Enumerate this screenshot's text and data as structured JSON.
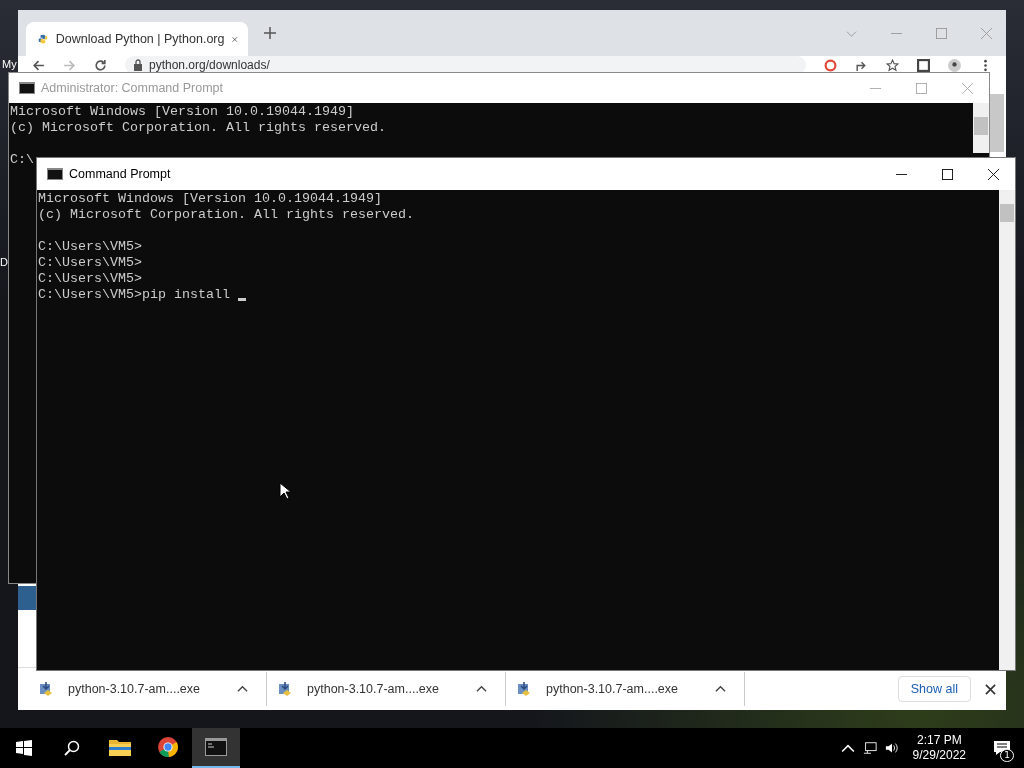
{
  "desktop": {
    "icon_labels": [
      "My",
      "D"
    ]
  },
  "browser": {
    "tab_title": "Download Python | Python.org",
    "url": "python.org/downloads/",
    "downloads": [
      {
        "file": "python-3.10.7-am....exe"
      },
      {
        "file": "python-3.10.7-am....exe"
      },
      {
        "file": "python-3.10.7-am....exe"
      }
    ],
    "show_all": "Show all"
  },
  "admin_console": {
    "title": "Administrator: Command Prompt",
    "header_lines": [
      "Microsoft Windows [Version 10.0.19044.1949]",
      "(c) Microsoft Corporation. All rights reserved."
    ],
    "prompt_lines": [
      "C:\\"
    ]
  },
  "console": {
    "title": "Command Prompt",
    "header_lines": [
      "Microsoft Windows [Version 10.0.19044.1949]",
      "(c) Microsoft Corporation. All rights reserved."
    ],
    "prompt_lines": [
      "C:\\Users\\VM5>",
      "C:\\Users\\VM5>",
      "C:\\Users\\VM5>",
      "C:\\Users\\VM5>pip install "
    ]
  },
  "taskbar": {
    "apps": [
      {
        "kind": "files",
        "selected": false
      },
      {
        "kind": "chrome",
        "selected": false
      },
      {
        "kind": "terminal",
        "selected": true
      }
    ],
    "time": "2:17 PM",
    "date": "9/29/2022",
    "notification_count": "1"
  }
}
